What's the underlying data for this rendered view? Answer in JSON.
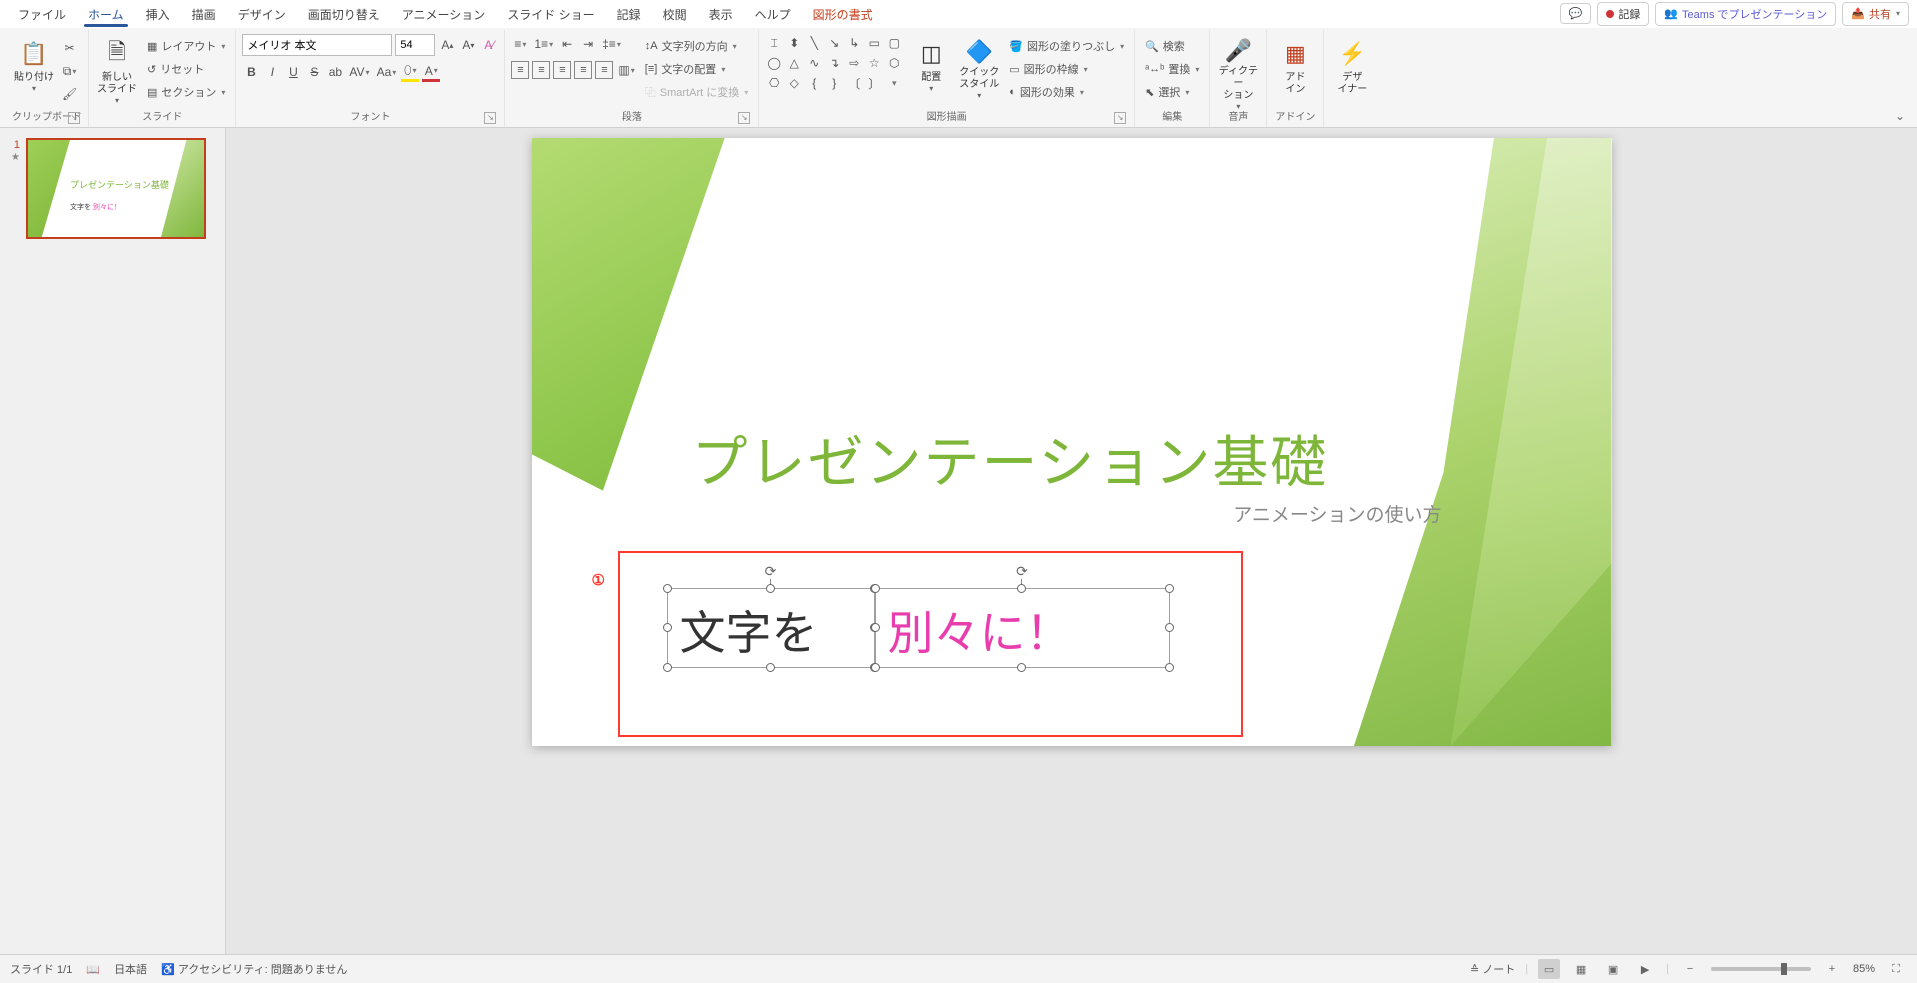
{
  "tabs": {
    "items": [
      "ファイル",
      "ホーム",
      "挿入",
      "描画",
      "デザイン",
      "画面切り替え",
      "アニメーション",
      "スライド ショー",
      "記録",
      "校閲",
      "表示",
      "ヘルプ"
    ],
    "context": "図形の書式",
    "active": "ホーム"
  },
  "topbtns": {
    "comment": "",
    "record": "記録",
    "teams": "Teams でプレゼンテーション",
    "share": "共有"
  },
  "ribbon": {
    "clipboard": {
      "label": "クリップボード",
      "paste": "貼り付け"
    },
    "slides": {
      "label": "スライド",
      "newslide": "新しい\nスライド",
      "layout": "レイアウト",
      "reset": "リセット",
      "section": "セクション"
    },
    "font": {
      "label": "フォント",
      "name": "メイリオ 本文",
      "size": "54"
    },
    "paragraph": {
      "label": "段落",
      "dir": "文字列の方向",
      "align": "文字の配置",
      "smartart": "SmartArt に変換"
    },
    "drawing": {
      "label": "図形描画",
      "arrange": "配置",
      "quick": "クイック\nスタイル",
      "fill": "図形の塗りつぶし",
      "outline": "図形の枠線",
      "effects": "図形の効果"
    },
    "editing": {
      "label": "編集",
      "find": "検索",
      "replace": "置換",
      "select": "選択"
    },
    "voice": {
      "label": "音声",
      "dictate": "ディクテー\nション"
    },
    "addins": {
      "label": "アドイン",
      "addin": "アド\nイン"
    },
    "designer": {
      "label": "",
      "designideas": "デザ\nイナー"
    }
  },
  "thumbs": {
    "n": "1",
    "title": "プレゼンテーション基礎",
    "t1": "文字を ",
    "t2": "別々に！"
  },
  "slide": {
    "title": "プレゼンテーション基礎",
    "subtitle": "アニメーションの使い方",
    "shape1": "文字を",
    "shape2": "別々に！",
    "annon": "①"
  },
  "status": {
    "slide": "スライド 1/1",
    "lang": "日本語",
    "access": "アクセシビリティ: 問題ありません",
    "notes": "ノート",
    "zoom": "85%"
  }
}
